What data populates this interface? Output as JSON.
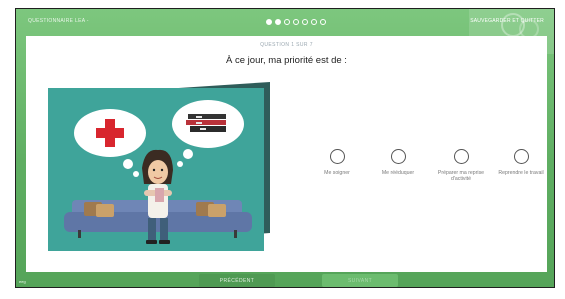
{
  "header": {
    "app_title": "QUESTIONNAIRE LEA -",
    "save_label": "SAUVEGARDER ET QUITTER",
    "progress_total": 7,
    "progress_filled": 2
  },
  "question": {
    "label": "QUESTION 1 SUR 7",
    "title": "À ce jour, ma priorité est de :"
  },
  "options": [
    {
      "label": "Me soigner"
    },
    {
      "label": "Me rééduquer"
    },
    {
      "label": "Préparer ma reprise d'activité"
    },
    {
      "label": "Reprendre le travail"
    }
  ],
  "footer": {
    "prev_label": "PRÉCÉDENT",
    "next_label": "SUIVANT",
    "corner_tag": "eeg"
  },
  "colors": {
    "frame_green": "#5fae62",
    "illustration_teal": "#3fa49a",
    "sofa_blue": "#6f86b6"
  }
}
